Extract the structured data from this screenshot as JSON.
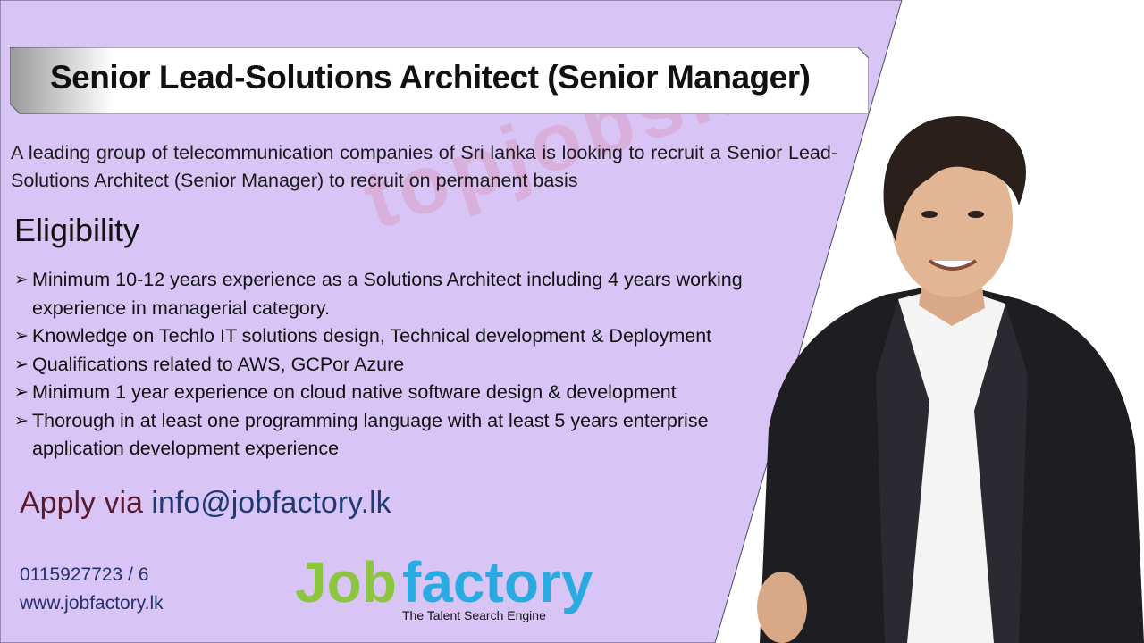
{
  "job_ad": {
    "title": "Senior Lead-Solutions Architect (Senior Manager)",
    "intro": "A leading group of telecommunication companies of Sri lanka is looking to recruit a Senior Lead-Solutions Architect (Senior Manager) to recruit on permanent basis",
    "eligibility_heading": "Eligibility",
    "bullet_glyph": "➢",
    "bullets": [
      "Minimum 10-12 years experience as a Solutions Architect including 4 years working experience in managerial category.",
      "Knowledge on Techlo IT solutions design, Technical development & Deployment",
      "Qualifications related to AWS, GCPor Azure",
      "Minimum 1 year experience on cloud native software design & development",
      "Thorough in at least one programming language with at least 5 years enterprise application development experience"
    ],
    "apply_label": "Apply via ",
    "apply_email": "info@jobfactory.lk",
    "phone": "0115927723 / 6",
    "website": "www.jobfactory.lk",
    "watermark": "topjobs.lk"
  },
  "logo": {
    "job": "Job",
    "factory": "factory",
    "tagline": "The Talent Search Engine"
  },
  "colors": {
    "panel": "#d8c5f5",
    "logo_green": "#8cc63f",
    "logo_blue": "#29abe2",
    "apply_label": "#5a1a2e",
    "apply_email": "#1f3a73",
    "contact": "#23306b"
  }
}
